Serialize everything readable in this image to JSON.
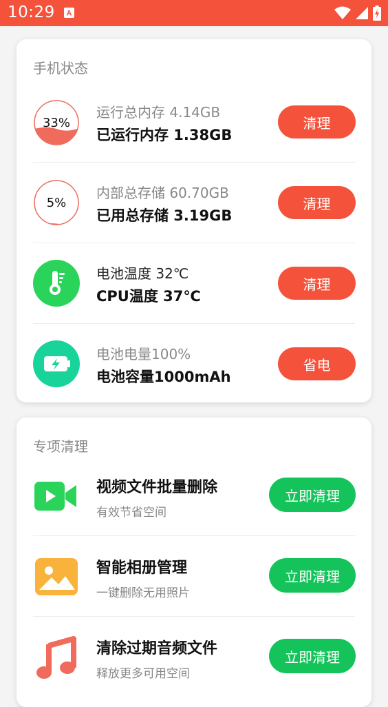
{
  "status_bar": {
    "time": "10:29",
    "bg_color": "#f5523b",
    "icons": [
      "notification-a-icon",
      "wifi-icon",
      "signal-icon",
      "battery-charging-icon"
    ]
  },
  "phone_status": {
    "title": "手机状态",
    "rows": [
      {
        "icon": "memory-ring-icon",
        "percent": "33%",
        "fill": 0.33,
        "line1": "运行总内存 4.14GB",
        "line2": "已运行内存 1.38GB",
        "button": "清理"
      },
      {
        "icon": "storage-ring-icon",
        "percent": "5%",
        "fill": 0.05,
        "line1": "内部总存储 60.70GB",
        "line2": "已用总存储 3.19GB",
        "button": "清理"
      },
      {
        "icon": "thermometer-icon",
        "line1": "电池温度 32℃",
        "line2": "CPU温度 37℃",
        "button": "清理"
      },
      {
        "icon": "battery-icon",
        "line1": "电池电量100%",
        "line2": "电池容量1000mAh",
        "button": "省电"
      }
    ]
  },
  "special_clean": {
    "title": "专项清理",
    "rows": [
      {
        "icon": "video-camera-icon",
        "title": "视频文件批量删除",
        "subtitle": "有效节省空间",
        "button": "立即清理"
      },
      {
        "icon": "photo-album-icon",
        "title": "智能相册管理",
        "subtitle": "一键删除无用照片",
        "button": "立即清理"
      },
      {
        "icon": "music-note-icon",
        "title": "清除过期音频文件",
        "subtitle": "释放更多可用空间",
        "button": "立即清理"
      }
    ]
  },
  "colors": {
    "accent_red": "#f5523b",
    "accent_green": "#14c45a",
    "teal": "#19d49a"
  }
}
